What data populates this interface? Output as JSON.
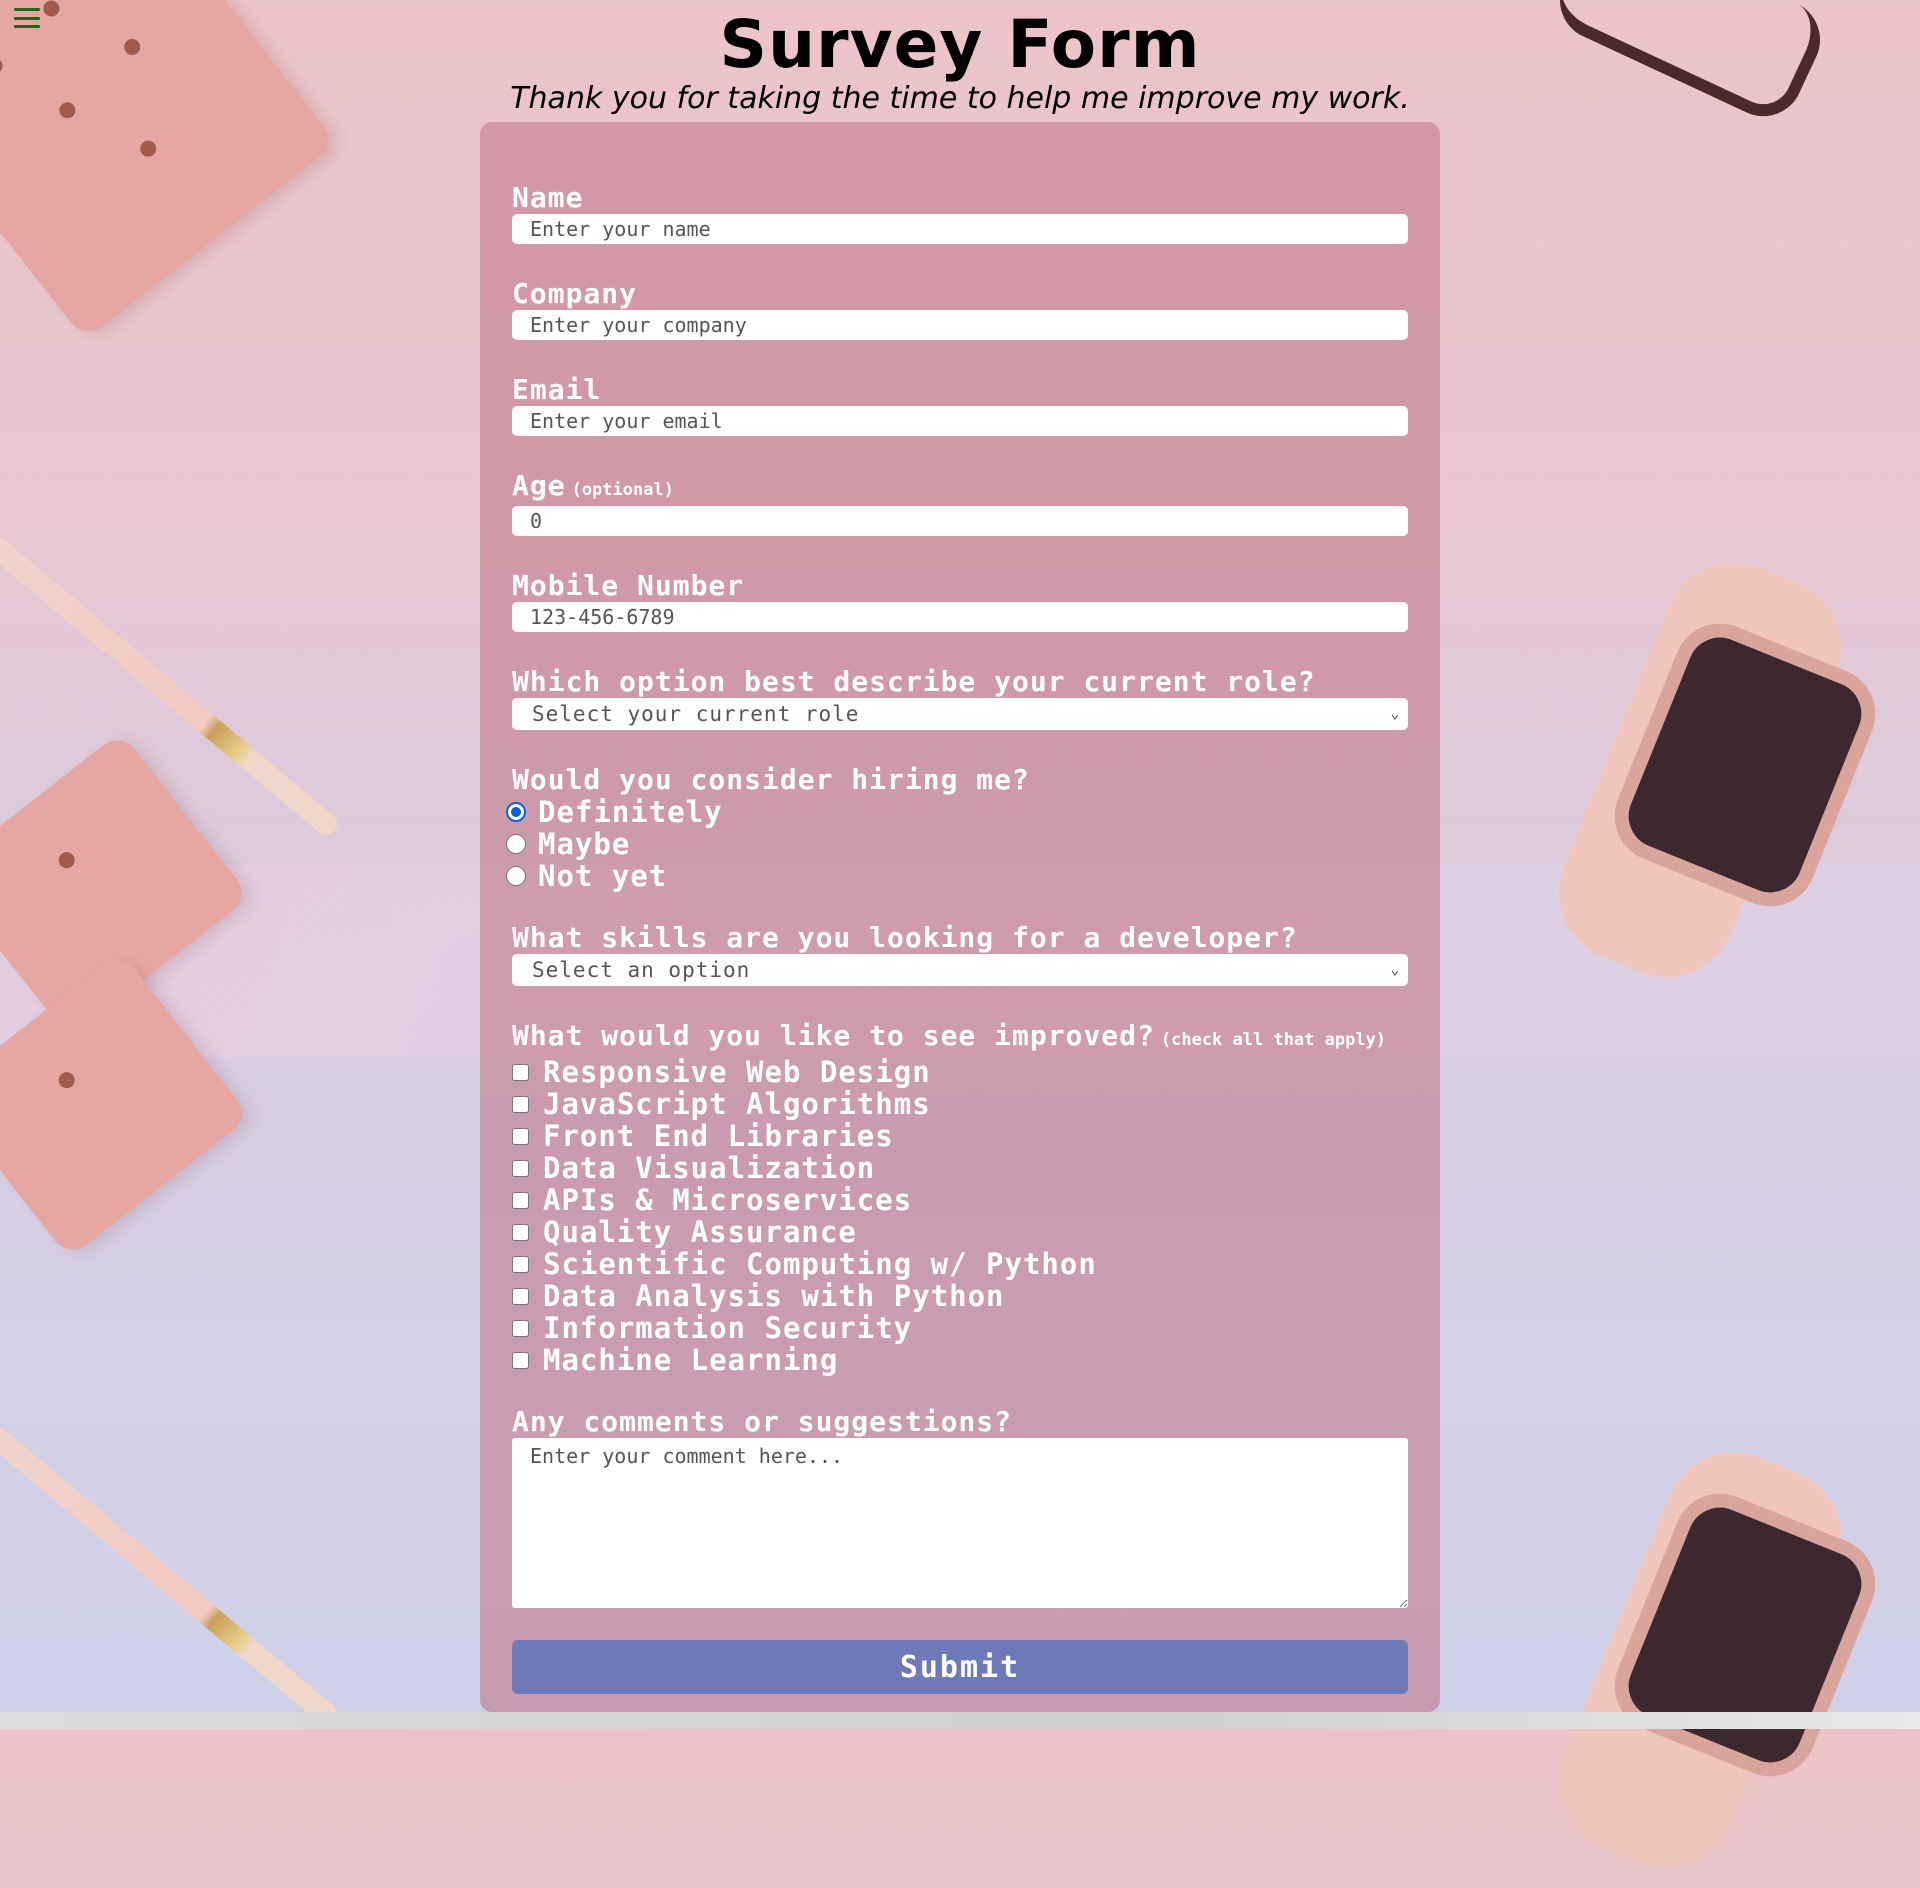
{
  "header": {
    "title": "Survey Form",
    "subtitle": "Thank you for taking the time to help me improve my work."
  },
  "menu": {
    "icon": "hamburger-menu-icon",
    "color": "#166b16"
  },
  "form": {
    "name": {
      "label": "Name",
      "placeholder": "Enter your name"
    },
    "company": {
      "label": "Company",
      "placeholder": "Enter your company"
    },
    "email": {
      "label": "Email",
      "placeholder": "Enter your email"
    },
    "age": {
      "label": "Age",
      "note": "(optional)",
      "placeholder": "0"
    },
    "mobile": {
      "label": "Mobile Number",
      "placeholder": "123-456-6789"
    },
    "role": {
      "label": "Which option best describe your current role?",
      "selected": "Select your current role"
    },
    "hiring": {
      "label": "Would you consider hiring me?",
      "options": [
        "Definitely",
        "Maybe",
        "Not yet"
      ],
      "selected": "Definitely"
    },
    "skills": {
      "label": "What skills are you looking for a developer?",
      "selected": "Select an option"
    },
    "improve": {
      "label": "What would you like to see improved?",
      "note": "(check all that apply)",
      "options": [
        "Responsive Web Design",
        "JavaScript Algorithms",
        "Front End Libraries",
        "Data Visualization",
        "APIs & Microservices",
        "Quality Assurance",
        "Scientific Computing w/ Python",
        "Data Analysis with Python",
        "Information Security",
        "Machine Learning"
      ]
    },
    "comments": {
      "label": "Any comments or suggestions?",
      "placeholder": "Enter your comment here..."
    },
    "submit_label": "Submit"
  },
  "colors": {
    "card": "#c47d8e",
    "submit": "#6e7ab8",
    "radio_checked": "#0b5fe0",
    "label_text": "#ffffff"
  }
}
